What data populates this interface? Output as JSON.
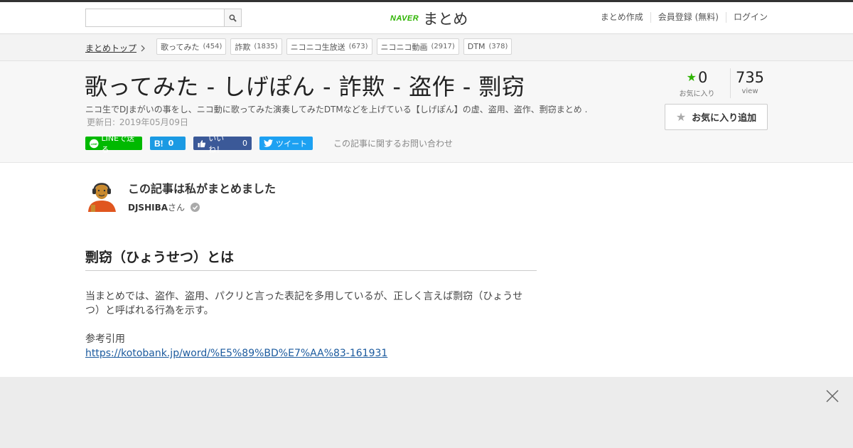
{
  "header": {
    "search_placeholder": "",
    "logo_naver": "NAVER",
    "logo_matome": "まとめ",
    "nav": [
      "まとめ作成",
      "会員登録 (無料)",
      "ログイン"
    ]
  },
  "tagbar": {
    "crumb": "まとめトップ",
    "tags": [
      {
        "label": "歌ってみた",
        "count": "(454)"
      },
      {
        "label": "詐欺",
        "count": "(1835)"
      },
      {
        "label": "ニコニコ生放送",
        "count": "(673)"
      },
      {
        "label": "ニコニコ動画",
        "count": "(2917)"
      },
      {
        "label": "DTM",
        "count": "(378)"
      }
    ]
  },
  "article": {
    "title": "歌ってみた - しげぽん - 詐欺 - 盗作 - 剽窃",
    "description": "ニコ生でDJまがいの事をし、ニコ動に歌ってみた演奏してみたDTMなどを上げている【しげぽん】の虚、盗用、盗作、剽窃まとめ .",
    "updated_label": "更新日:",
    "updated_date": "2019年05月09日",
    "favorites": "0",
    "favorites_label": "お気に入り",
    "views": "735",
    "views_label": "view",
    "fav_button": "お気に入り追加",
    "inquiry": "この記事に関するお問い合わせ"
  },
  "share": {
    "line": "LINEで送る",
    "hatena_count": "0",
    "facebook": "いいね！",
    "facebook_count": "0",
    "twitter": "ツイート"
  },
  "author": {
    "heading": "この記事は私がまとめました",
    "name": "DJSHIBA",
    "suffix": "さん"
  },
  "content": {
    "h2": "剽窃（ひょうせつ）とは",
    "p1": "当まとめでは、盗作、盗用、パクリと言った表記を多用しているが、正しく言えば剽窃（ひょうせつ）と呼ばれる行為を示す。",
    "p2": "参考引用",
    "link": "https://kotobank.jp/word/%E5%89%BD%E7%AA%83-161931"
  },
  "colors": {
    "brand_green": "#2db400",
    "link_blue": "#1b5a9e"
  }
}
